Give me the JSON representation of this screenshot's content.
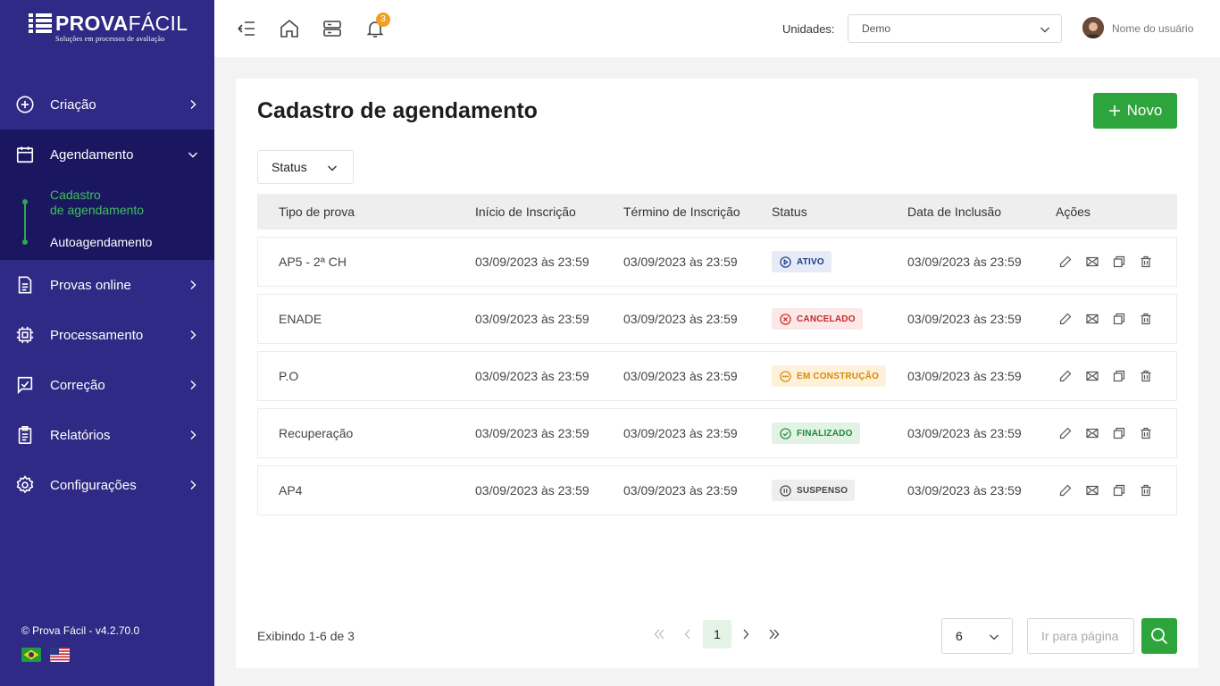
{
  "brand": {
    "name_bold": "PROVA",
    "name_light": "FÁCIL",
    "tagline": "Soluções em processos de avaliação"
  },
  "sidebar": {
    "items": [
      {
        "label": "Criação",
        "icon": "plus-circle-icon"
      },
      {
        "label": "Agendamento",
        "icon": "calendar-icon"
      },
      {
        "label": "Provas online",
        "icon": "document-icon"
      },
      {
        "label": "Processamento",
        "icon": "chip-icon"
      },
      {
        "label": "Correção",
        "icon": "check-square-icon"
      },
      {
        "label": "Relatórios",
        "icon": "clipboard-icon"
      },
      {
        "label": "Configurações",
        "icon": "gear-icon"
      }
    ],
    "subitems": [
      {
        "label_line1": "Cadastro",
        "label_line2": "de agendamento",
        "active": true
      },
      {
        "label": "Autoagendamento"
      }
    ],
    "footer_version": "© Prova Fácil - v4.2.70.0",
    "flags": [
      "brazil-flag-icon",
      "usa-flag-icon"
    ]
  },
  "topbar": {
    "notifications_count": "3",
    "unidades_label": "Unidades:",
    "unidades_value": "Demo",
    "user_name": "Nome do usuário"
  },
  "page": {
    "title": "Cadastro de agendamento",
    "new_button": "Novo",
    "status_filter": "Status"
  },
  "table": {
    "headers": [
      "Tipo de prova",
      "Início de Inscrição",
      "Término de Inscrição",
      "Status",
      "Data de Inclusão",
      "Ações"
    ],
    "rows": [
      {
        "tipo": "AP5 - 2ª CH",
        "inicio": "03/09/2023 às 23:59",
        "termino": "03/09/2023 às 23:59",
        "status": "ATIVO",
        "inclusao": "03/09/2023 às 23:59"
      },
      {
        "tipo": "ENADE",
        "inicio": "03/09/2023 às 23:59",
        "termino": "03/09/2023 às 23:59",
        "status": "CANCELADO",
        "inclusao": "03/09/2023 às 23:59"
      },
      {
        "tipo": "P.O",
        "inicio": "03/09/2023 às 23:59",
        "termino": "03/09/2023 às 23:59",
        "status": "EM CONSTRUÇÃO",
        "inclusao": "03/09/2023 às 23:59"
      },
      {
        "tipo": "Recuperação",
        "inicio": "03/09/2023 às 23:59",
        "termino": "03/09/2023 às 23:59",
        "status": "FINALIZADO",
        "inclusao": "03/09/2023 às 23:59"
      },
      {
        "tipo": "AP4",
        "inicio": "03/09/2023 às 23:59",
        "termino": "03/09/2023 às 23:59",
        "status": "SUSPENSO",
        "inclusao": "03/09/2023 às 23:59"
      }
    ],
    "status_colors": {
      "ATIVO": {
        "fg": "#1e3a8a",
        "bg": "#e6ebf7"
      },
      "CANCELADO": {
        "fg": "#c62828",
        "bg": "#fde8e8"
      },
      "EM CONSTRUÇÃO": {
        "fg": "#d98a00",
        "bg": "#fdf1dc"
      },
      "FINALIZADO": {
        "fg": "#1f8a3a",
        "bg": "#e2f3e5"
      },
      "SUSPENSO": {
        "fg": "#444444",
        "bg": "#eeeeee"
      }
    },
    "actions": [
      "edit-icon",
      "mail-icon",
      "copy-icon",
      "trash-icon"
    ]
  },
  "pagination": {
    "showing": "Exibindo 1-6 de 3",
    "current_page": "1",
    "per_page": "6",
    "goto_placeholder": "Ir para página"
  },
  "colors": {
    "sidebar": "#2e2a85",
    "sidebar_active": "#1a1760",
    "accent_green": "#2ea53c"
  }
}
